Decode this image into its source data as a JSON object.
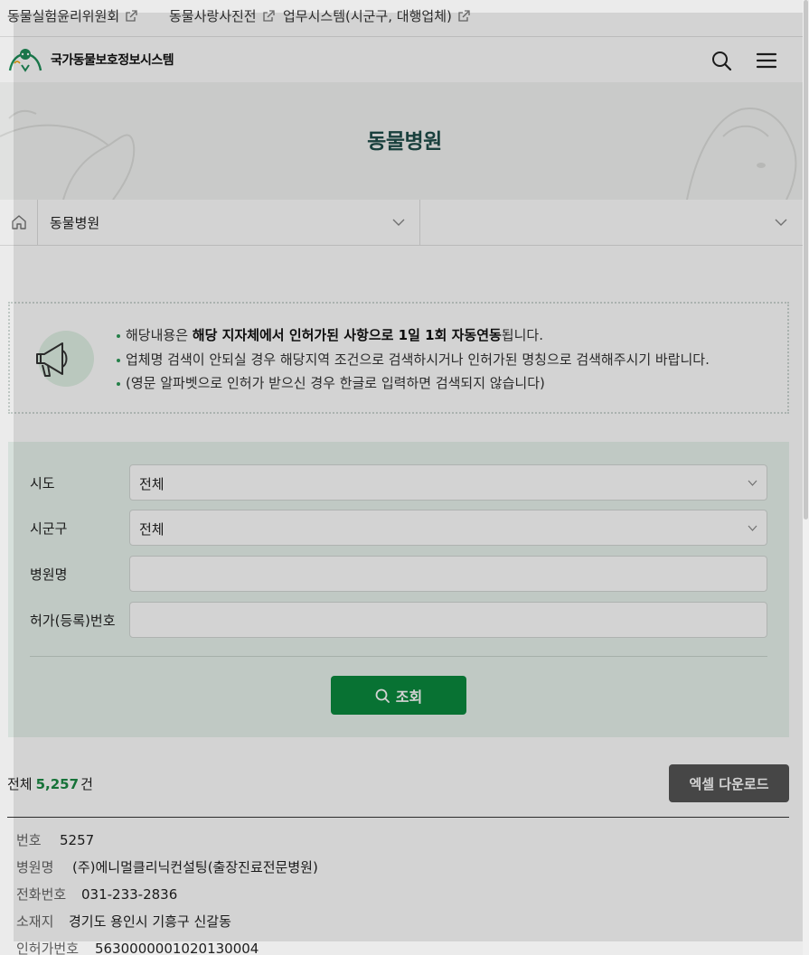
{
  "utility_links": [
    {
      "label": "동물실험윤리위원회"
    },
    {
      "label": "동물사랑사진전"
    },
    {
      "label": "업무시스템(시군구, 대행업체)"
    }
  ],
  "header": {
    "site_title": "국가동물보호정보시스템",
    "search_icon": "search-icon",
    "menu_icon": "hamburger-menu-icon"
  },
  "hero": {
    "title": "동물병원"
  },
  "location": {
    "home_icon": "home-icon",
    "depth1": "동물병원",
    "depth2": ""
  },
  "notice": {
    "icon": "megaphone-icon",
    "line1_pre": "해당내용은 ",
    "line1_bold": "해당 지자체에서 인허가된 사항으로 1일 1회 자동연동",
    "line1_post": "됩니다.",
    "line2": "업체명 검색이 안되실 경우 해당지역 조건으로 검색하시거나 인허가된 명칭으로 검색해주시기 바랍니다.",
    "line3": "(영문 알파벳으로 인허가 받으신 경우 한글로 입력하면 검색되지 않습니다)"
  },
  "search": {
    "sido_label": "시도",
    "sido_value": "전체",
    "sigungu_label": "시군구",
    "sigungu_value": "전체",
    "hospital_label": "병원명",
    "hospital_value": "",
    "license_label": "허가(등록)번호",
    "license_value": "",
    "submit_label": "조회"
  },
  "results": {
    "total_prefix": "전체",
    "total_count": "5,257",
    "total_suffix": "건",
    "excel_label": "엑셀 다운로드"
  },
  "record": {
    "no_label": "번호",
    "no_value": "5257",
    "name_label": "병원명",
    "name_value": "(주)에니멀클리닉컨설팅(출장진료전문병원)",
    "phone_label": "전화번호",
    "phone_value": "031-233-2836",
    "addr_label": "소재지",
    "addr_value": "경기도 용인시 기흥구 신갈동",
    "license_label": "인허가번호",
    "license_value": "5630000001020130004"
  },
  "colors": {
    "primary_green": "#0b8a3e",
    "count_green": "#1c8a45",
    "form_bg": "#e9f4ee",
    "hero_title": "#1f4f4b"
  }
}
